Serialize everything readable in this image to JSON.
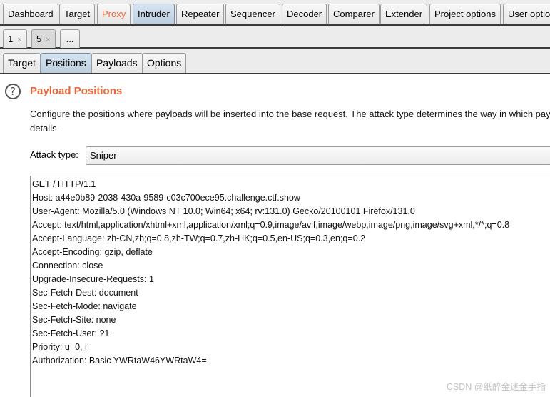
{
  "top_tabs": [
    "Dashboard",
    "Target",
    "Proxy",
    "Intruder",
    "Repeater",
    "Sequencer",
    "Decoder",
    "Comparer",
    "Extender",
    "Project options",
    "User optio"
  ],
  "num_tabs": [
    "1",
    "5",
    "..."
  ],
  "close_glyph": "×",
  "sub_tabs": [
    "Target",
    "Positions",
    "Payloads",
    "Options"
  ],
  "section": {
    "help_glyph": "?",
    "title": "Payload Positions",
    "description": "Configure the positions where payloads will be inserted into the base request. The attack type determines the way in which pay details."
  },
  "attack": {
    "label": "Attack type:",
    "value": "Sniper"
  },
  "request_lines": [
    "GET / HTTP/1.1",
    "Host: a44e0b89-2038-430a-9589-c03c700ece95.challenge.ctf.show",
    "User-Agent: Mozilla/5.0 (Windows NT 10.0; Win64; x64; rv:131.0) Gecko/20100101 Firefox/131.0",
    "Accept: text/html,application/xhtml+xml,application/xml;q=0.9,image/avif,image/webp,image/png,image/svg+xml,*/*;q=0.8",
    "Accept-Language: zh-CN,zh;q=0.8,zh-TW;q=0.7,zh-HK;q=0.5,en-US;q=0.3,en;q=0.2",
    "Accept-Encoding: gzip, deflate",
    "Connection: close",
    "Upgrade-Insecure-Requests: 1",
    "Sec-Fetch-Dest: document",
    "Sec-Fetch-Mode: navigate",
    "Sec-Fetch-Site: none",
    "Sec-Fetch-User: ?1",
    "Priority: u=0, i",
    "Authorization: Basic YWRtaW46YWRtaW4="
  ],
  "watermark": "CSDN @纸醉金迷金手指",
  "colors": {
    "accent": "#e8673a",
    "active_tab": "#c9d8e6"
  }
}
